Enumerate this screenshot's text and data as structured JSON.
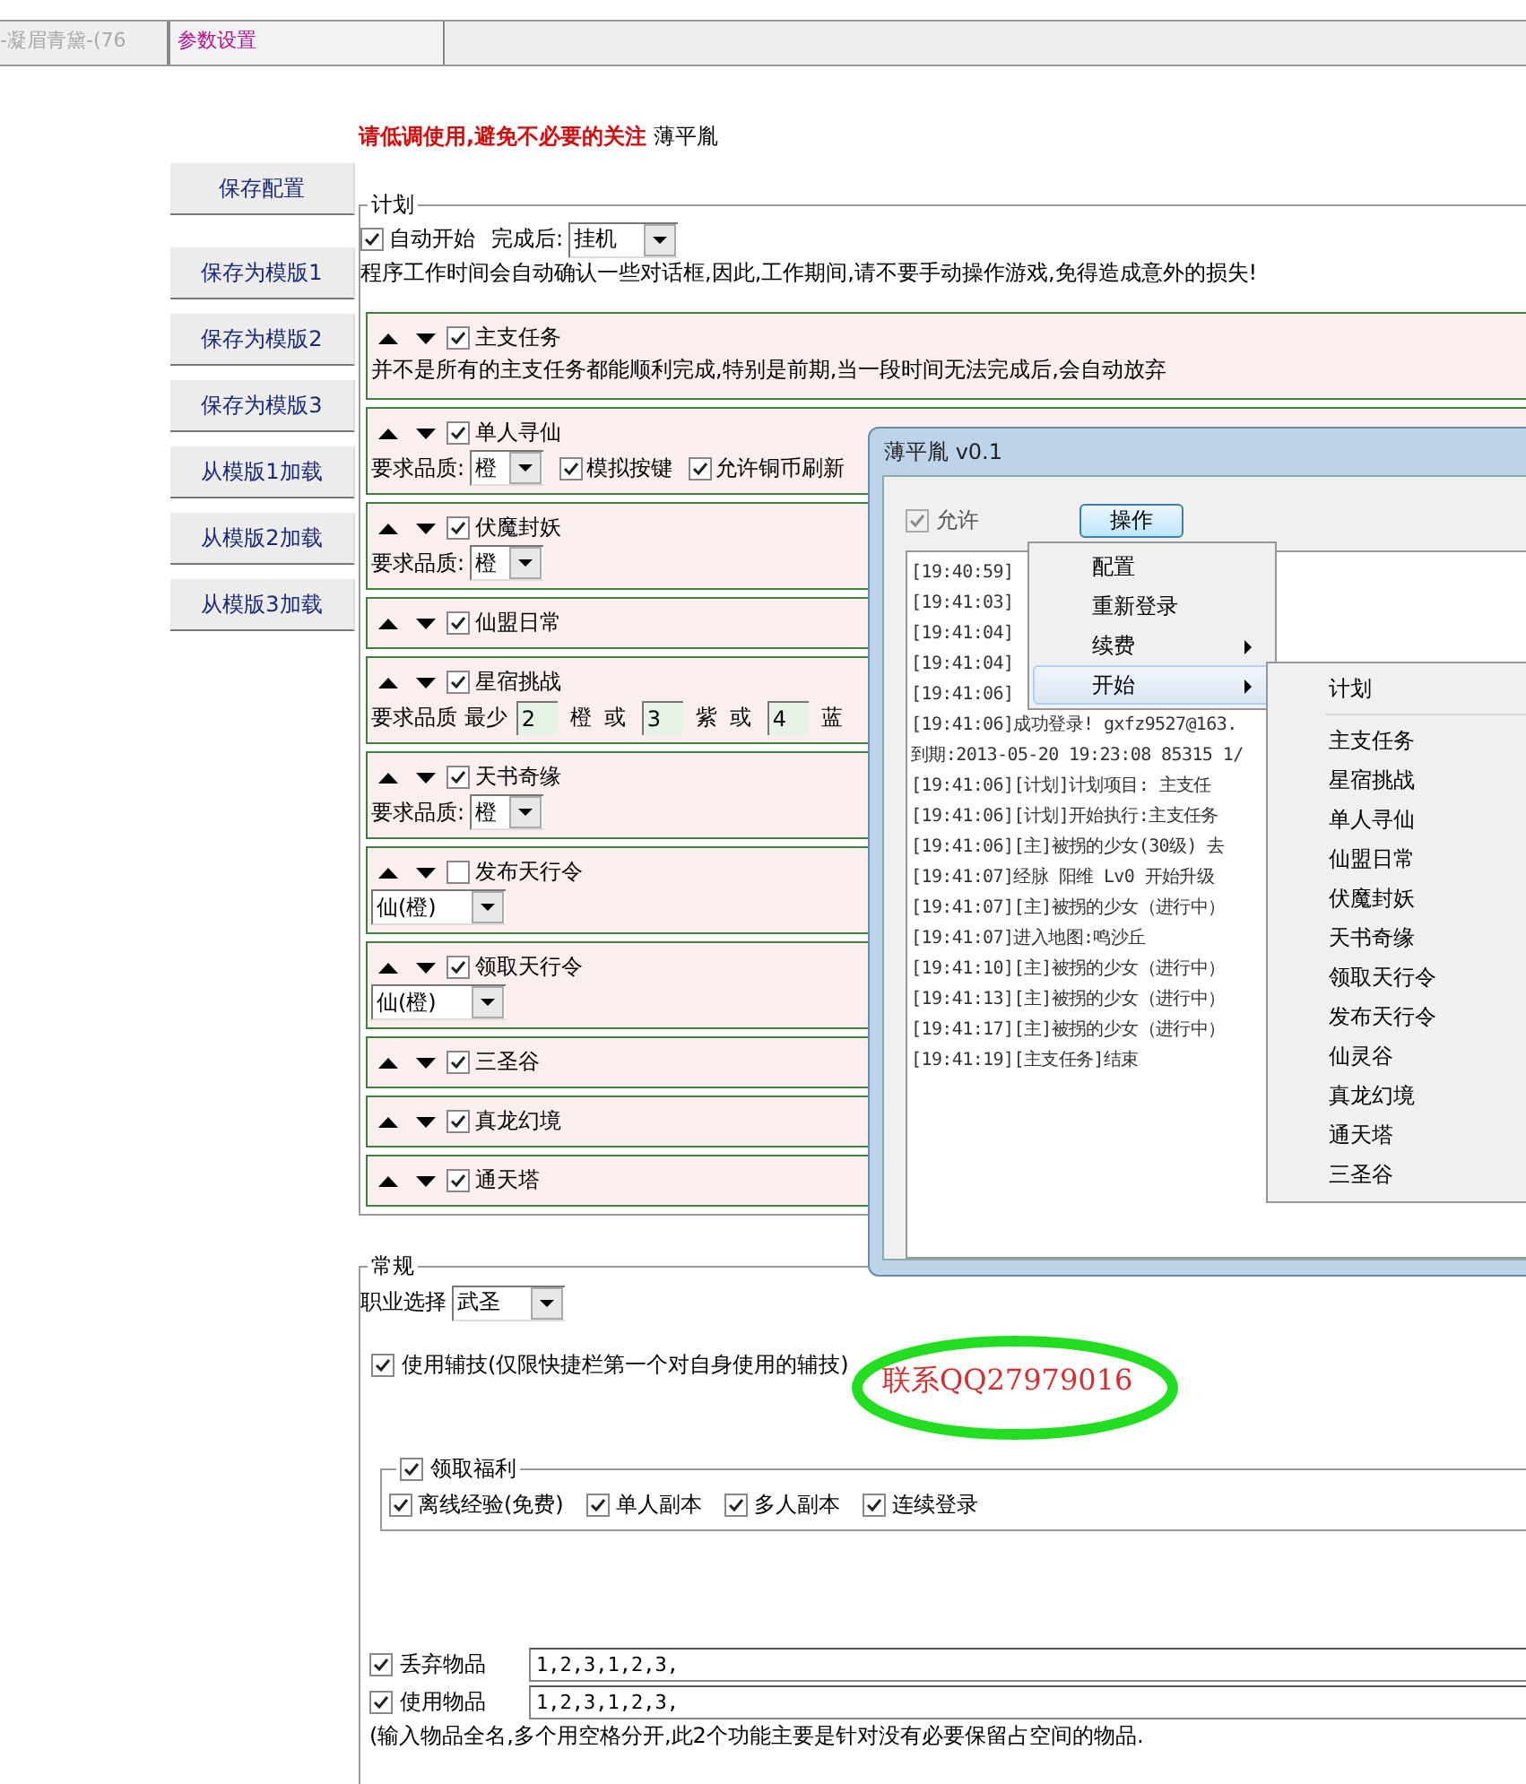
{
  "tabs": [
    {
      "label": "-凝眉青黛-(76",
      "selected": false
    },
    {
      "label": "参数设置",
      "selected": true
    }
  ],
  "warning": {
    "emphasis": "请低调使用,避免不必要的关注",
    "name": "薄平胤"
  },
  "side_buttons": [
    "保存配置",
    "保存为模版1",
    "保存为模版2",
    "保存为模版3",
    "从模版1加载",
    "从模版2加载",
    "从模版3加载"
  ],
  "plan": {
    "legend": "计划",
    "auto_start": {
      "label": "自动开始",
      "checked": true
    },
    "after_label": "完成后:",
    "after_value": "挂机",
    "notice": "程序工作时间会自动确认一些对话框,因此,工作期间,请不要手动操作游戏,免得造成意外的损失!",
    "tasks": [
      {
        "kind": "note",
        "name": "主支任务",
        "checked": true,
        "note": "并不是所有的主支任务都能顺利完成,特别是前期,当一段时间无法完成后,会自动放弃"
      },
      {
        "kind": "quality",
        "name": "单人寻仙",
        "checked": true,
        "quality_label": "要求品质:",
        "quality": "橙",
        "options": [
          {
            "label": "模拟按键",
            "checked": true
          },
          {
            "label": "允许铜币刷新",
            "checked": true
          }
        ]
      },
      {
        "kind": "quality",
        "name": "伏魔封妖",
        "checked": true,
        "quality_label": "要求品质:",
        "quality": "橙"
      },
      {
        "kind": "plain",
        "name": "仙盟日常",
        "checked": true
      },
      {
        "kind": "counts",
        "name": "星宿挑战",
        "checked": true,
        "counts_label": "要求品质 最少",
        "parts": [
          {
            "value": "2",
            "unit": "橙"
          },
          {
            "joiner": "或",
            "value": "3",
            "unit": "紫"
          },
          {
            "joiner": "或",
            "value": "4",
            "unit": "蓝"
          }
        ]
      },
      {
        "kind": "quality",
        "name": "天书奇缘",
        "checked": true,
        "quality_label": "要求品质:",
        "quality": "橙"
      },
      {
        "kind": "tier",
        "name": "发布天行令",
        "checked": false,
        "tier": "仙(橙)"
      },
      {
        "kind": "tier",
        "name": "领取天行令",
        "checked": true,
        "tier": "仙(橙)"
      },
      {
        "kind": "plain",
        "name": "三圣谷",
        "checked": true
      },
      {
        "kind": "plain",
        "name": "真龙幻境",
        "checked": true
      },
      {
        "kind": "plain",
        "name": "通天塔",
        "checked": true
      }
    ]
  },
  "general": {
    "legend": "常规",
    "job_label": "职业选择",
    "job": "武圣",
    "assist": {
      "label": "使用辅技(仅限快捷栏第一个对自身使用的辅技)",
      "checked": true
    },
    "annotation": "联系QQ27979016",
    "welfare": {
      "label": "领取福利",
      "checked": true,
      "options": [
        {
          "label": "离线经验(免费)",
          "checked": true
        },
        {
          "label": "单人副本",
          "checked": true
        },
        {
          "label": "多人副本",
          "checked": true
        },
        {
          "label": "连续登录",
          "checked": true
        }
      ]
    },
    "items": [
      {
        "label": "丢弃物品",
        "checked": true,
        "value": "1,2,3,1,2,3,"
      },
      {
        "label": "使用物品",
        "checked": true,
        "value": "1,2,3,1,2,3,"
      }
    ],
    "items_note": "(输入物品全名,多个用空格分开,此2个功能主要是针对没有必要保留占空间的物品."
  },
  "window": {
    "title": "薄平胤 v0.1",
    "allow": {
      "label": "允许",
      "checked": true,
      "disabled": true
    },
    "action_button": "操作",
    "log": [
      "[19:40:59]",
      "[19:41:03]",
      "[19:41:04]",
      "[19:41:04]",
      "[19:41:06]",
      "[19:41:06]成功登录! gxfz9527@163.",
      "到期:2013-05-20 19:23:08 85315 1/",
      "[19:41:06][计划]计划项目: 主支任",
      "[19:41:06][计划]开始执行:主支任务",
      "[19:41:06][主]被拐的少女(30级) 去",
      "[19:41:07]经脉 阳维 Lv0 开始升级",
      "[19:41:07][主]被拐的少女（进行中）",
      "[19:41:07]进入地图:鸣沙丘",
      "[19:41:10][主]被拐的少女（进行中）",
      "[19:41:13][主]被拐的少女（进行中）",
      "[19:41:17][主]被拐的少女（进行中）",
      "[19:41:19][主支任务]结束"
    ],
    "menu": [
      {
        "label": "配置",
        "highlighted": false,
        "submenu": false
      },
      {
        "label": "重新登录",
        "highlighted": false,
        "submenu": false
      },
      {
        "label": "续费",
        "highlighted": false,
        "submenu": true
      },
      {
        "label": "开始",
        "highlighted": true,
        "submenu": true
      }
    ],
    "submenu": [
      {
        "label": "计划",
        "separator_after": true
      },
      {
        "label": "主支任务",
        "separator_after": false
      },
      {
        "label": "星宿挑战",
        "separator_after": false
      },
      {
        "label": "单人寻仙",
        "separator_after": false
      },
      {
        "label": "仙盟日常",
        "separator_after": false
      },
      {
        "label": "伏魔封妖",
        "separator_after": false
      },
      {
        "label": "天书奇缘",
        "separator_after": false
      },
      {
        "label": "领取天行令",
        "separator_after": false
      },
      {
        "label": "发布天行令",
        "separator_after": false
      },
      {
        "label": "仙灵谷",
        "separator_after": false
      },
      {
        "label": "真龙幻境",
        "separator_after": false
      },
      {
        "label": "通天塔",
        "separator_after": false
      },
      {
        "label": "三圣谷",
        "separator_after": false
      }
    ]
  }
}
